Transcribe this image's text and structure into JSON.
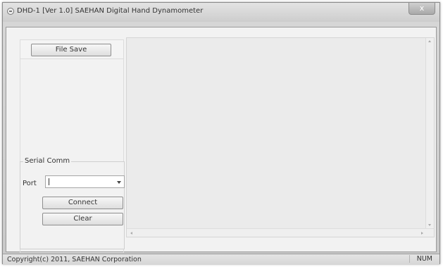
{
  "window": {
    "title": "DHD-1 [Ver 1.0] SAEHAN Digital Hand Dynamometer",
    "close_label": "x"
  },
  "toolbar": {
    "file_save_label": "File Save"
  },
  "serial": {
    "group_label": "Serial Comm",
    "port_label": "Port",
    "port_value": "",
    "connect_label": "Connect",
    "clear_label": "Clear"
  },
  "status": {
    "copyright": "Copyright(c) 2011, SAEHAN Corporation",
    "num_indicator": "NUM"
  },
  "icons": [
    "app-icon",
    "close-icon",
    "chevron-down-icon",
    "scroll-up-icon",
    "scroll-down-icon",
    "scroll-left-icon",
    "scroll-right-icon"
  ]
}
